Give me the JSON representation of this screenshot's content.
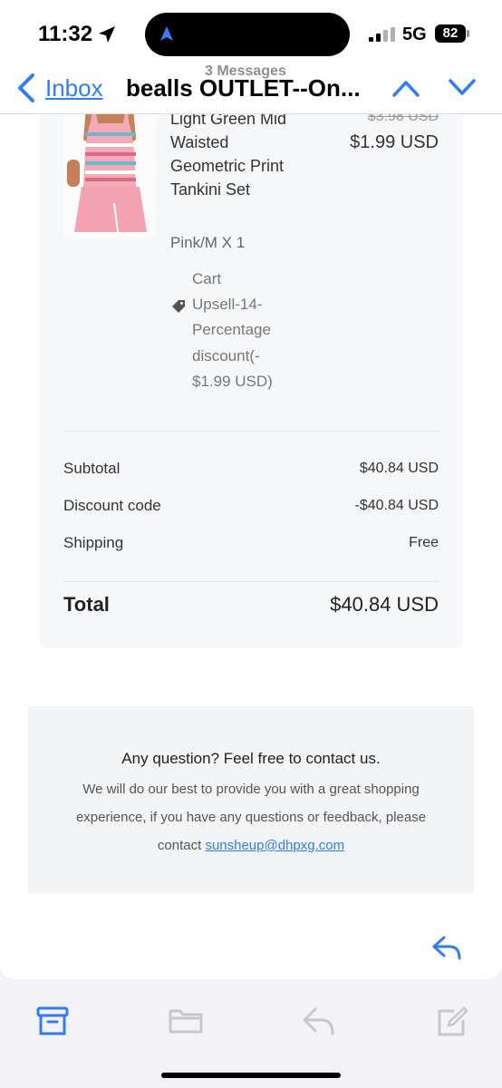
{
  "status": {
    "time": "11:32",
    "network": "5G",
    "battery": "82",
    "icons": [
      "location-arrow-icon",
      "navigation-icon",
      "signal-icon"
    ]
  },
  "nav": {
    "back_label": "Inbox",
    "message_count": "3 Messages",
    "subject": "bealls OUTLET--On..."
  },
  "product": {
    "name": "Light Green Mid Waisted Geometric Print Tankini Set",
    "price_original": "$3.98 USD",
    "price_current": "$1.99 USD",
    "variant": "Pink/M X 1",
    "discount_lines": [
      "Cart",
      "Upsell-14-",
      "Percentage",
      "discount(-",
      "$1.99 USD)"
    ]
  },
  "summary": {
    "rows": [
      {
        "label": "Subtotal",
        "value": "$40.84 USD"
      },
      {
        "label": "Discount code",
        "value": "-$40.84 USD"
      },
      {
        "label": "Shipping",
        "value": "Free"
      }
    ],
    "total_label": "Total",
    "total_value": "$40.84 USD"
  },
  "contact": {
    "title": "Any question? Feel free to contact us.",
    "body": "We will do our best to provide you with a great shopping experience, if you have any questions or feedback, please contact",
    "email": "sunsheup@dhpxg.com"
  },
  "colors": {
    "accent": "#2f7cf6",
    "card_bg": "#f6f7f9",
    "contact_bg": "#f3f4f6",
    "toolbar_icon": "#c7c7cc"
  },
  "toolbar": {
    "icons": [
      "archive-icon",
      "folder-icon",
      "reply-icon",
      "compose-icon"
    ]
  }
}
